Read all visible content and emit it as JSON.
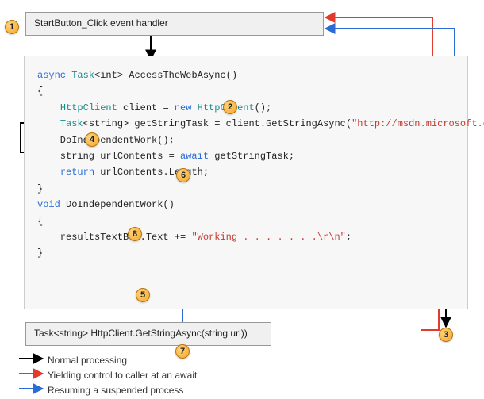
{
  "boxes": {
    "top_label": "StartButton_Click event handler",
    "bottom_label": "Task<string> HttpClient.GetStringAsync(string url))"
  },
  "code": {
    "l1": "async ",
    "l1b": "Task",
    "l1c": "<int> AccessTheWebAsync()",
    "l2": "{",
    "l3": "    ",
    "l3b": "HttpClient",
    "l3c": " client = ",
    "l3d": "new ",
    "l3e": "HttpClient",
    "l3f": "();",
    "l4": "",
    "l5": "    ",
    "l5b": "Task",
    "l5c": "<string> getStringTask = client.GetStringAsync(",
    "l5d": "\"http://msdn.microsoft.com\"",
    "l5e": ");",
    "l6": "",
    "l7": "    DoIndependentWork();",
    "l8": "",
    "l9": "    string urlContents = ",
    "l9b": "await",
    "l9c": " getStringTask;",
    "l10": "",
    "l11": "    ",
    "l11b": "return",
    "l11c": " urlContents.Length;",
    "l12": "}",
    "l13": "",
    "l14": "void",
    "l14b": " DoIndependentWork()",
    "l15": "{",
    "l16": "    resultsTextBox.Text += ",
    "l16b": "\"Working . . . . . . .\\r\\n\"",
    "l16c": ";",
    "l17": "}"
  },
  "markers": {
    "m1": "1",
    "m2": "2",
    "m3": "3",
    "m4": "4",
    "m5": "5",
    "m6": "6",
    "m7": "7",
    "m8": "8"
  },
  "legend": {
    "normal": "Normal processing",
    "yield": "Yielding control to caller at an await",
    "resume": "Resuming a suspended process"
  }
}
